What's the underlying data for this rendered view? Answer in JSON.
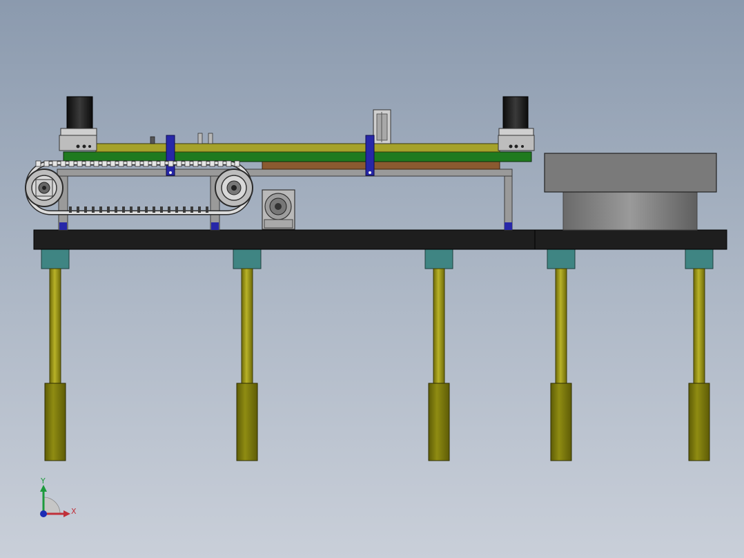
{
  "view": {
    "background_top": "#8b9aae",
    "background_bottom": "#c9cfd9"
  },
  "colors": {
    "table_top": "#1e1e1e",
    "leg_rod": "#a8a21c",
    "leg_cylinder": "#7c7a0a",
    "leg_cap": "#3f8583",
    "frame_gray": "#8e8e8e",
    "rail_olive": "#a5a22a",
    "rail_green": "#1f7a1f",
    "plate_brown": "#8a5a30",
    "bracket_blue": "#2727a8",
    "motor_black": "#141414",
    "block_gray": "#7a7a7a",
    "chain_light": "#e6e6e6"
  },
  "axis_triad": {
    "x_label": "X",
    "y_label": "Y",
    "x_color": "#c0303a",
    "y_color": "#1c9a3c",
    "z_color": "#1b2bb5"
  },
  "icons": {
    "stepper_motor": "stepper-motor-icon",
    "sprocket": "sprocket-icon",
    "gearbox": "gearbox-icon",
    "coordinate_triad": "coordinate-triad-icon"
  }
}
